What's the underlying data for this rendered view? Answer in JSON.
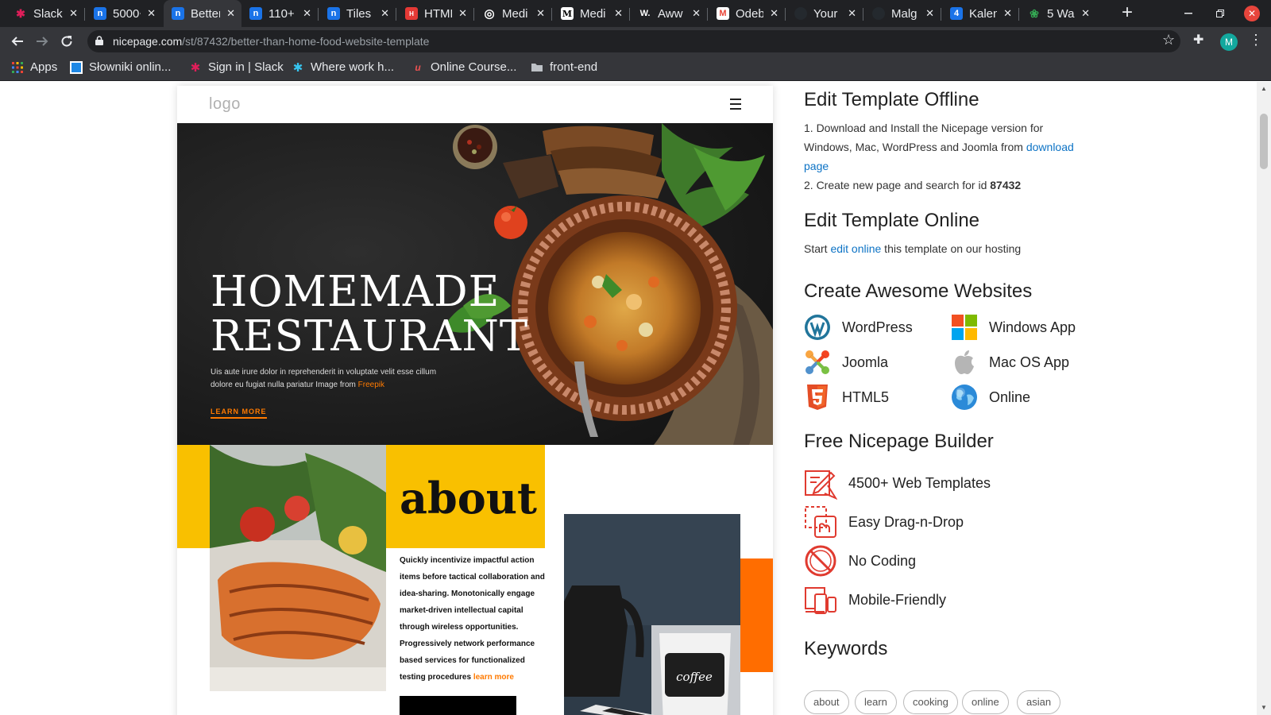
{
  "browser": {
    "tabs": [
      {
        "title": "Slack",
        "fav_color": "#611f69",
        "fav_glyph": "✱",
        "active": false
      },
      {
        "title": "5000+",
        "fav_color": "#1a73e8",
        "fav_glyph": "n",
        "active": false
      },
      {
        "title": "Better",
        "fav_color": "#1a73e8",
        "fav_glyph": "n",
        "active": true
      },
      {
        "title": "110+",
        "fav_color": "#1a73e8",
        "fav_glyph": "n",
        "active": false
      },
      {
        "title": "Tiles",
        "fav_color": "#1a73e8",
        "fav_glyph": "n",
        "active": false
      },
      {
        "title": "HTML",
        "fav_color": "#e53935",
        "fav_glyph": "H",
        "active": false
      },
      {
        "title": "Medi",
        "fav_color": "#5f6368",
        "fav_glyph": "◎",
        "active": false
      },
      {
        "title": "Medi",
        "fav_color": "#000000",
        "fav_glyph": "M",
        "active": false
      },
      {
        "title": "Aww",
        "fav_color": "#202124",
        "fav_glyph": "W.",
        "active": false
      },
      {
        "title": "Odeb",
        "fav_color": "#ffffff",
        "fav_glyph": "M",
        "active": false
      },
      {
        "title": "Your",
        "fav_color": "#24292e",
        "fav_glyph": "",
        "active": false
      },
      {
        "title": "Malg",
        "fav_color": "#24292e",
        "fav_glyph": "",
        "active": false
      },
      {
        "title": "Kalen",
        "fav_color": "#1a73e8",
        "fav_glyph": "4",
        "active": false
      },
      {
        "title": "5 Wa",
        "fav_color": "#34a853",
        "fav_glyph": "❀",
        "active": false
      }
    ],
    "close_glyph": "✕",
    "new_tab_glyph": "+",
    "url_host": "nicepage.com",
    "url_path": "/st/87432/better-than-home-food-website-template",
    "profile_initial": "M",
    "bookmarks": [
      {
        "label": "Apps",
        "icon": "apps-grid-icon"
      },
      {
        "label": "Słowniki onlin...",
        "icon": "dictionary-icon"
      },
      {
        "label": "Sign in | Slack",
        "icon": "slack-icon"
      },
      {
        "label": "Where work h...",
        "icon": "slack-icon"
      },
      {
        "label": "Online Course...",
        "icon": "udemy-icon"
      },
      {
        "label": "front-end",
        "icon": "folder-icon"
      }
    ]
  },
  "preview": {
    "logo": "logo",
    "hero": {
      "title_line1": "HOMEMADE",
      "title_line2": "RESTAURANT",
      "text": "Uis aute irure dolor in reprehenderit in voluptate velit esse cillum dolore eu fugiat nulla pariatur Image from ",
      "text_link": "Freepik",
      "cta": "LEARN MORE"
    },
    "about": {
      "title": "about",
      "text": "Quickly incentivize impactful action items before tactical collaboration and idea-sharing. Monotonically engage market-driven intellectual capital through wireless opportunities. Progressively network performance based services for functionalized testing procedures ",
      "link": "learn more",
      "mug_label": "coffee"
    }
  },
  "info": {
    "offline": {
      "heading": "Edit Template Offline",
      "step1_a": "1. Download and Install the Nicepage version for",
      "step1_b": "Windows, Mac, WordPress and Joomla from ",
      "step1_link": "download",
      "step1_link2": "page",
      "step2": "2. Create new page and search for id ",
      "template_id": "87432"
    },
    "online": {
      "heading": "Edit Template Online",
      "text_a": "Start ",
      "link": "edit online",
      "text_b": " this template on our hosting"
    },
    "create": {
      "heading": "Create Awesome Websites",
      "apps": [
        {
          "label": "WordPress",
          "icon": "wordpress-icon"
        },
        {
          "label": "Windows App",
          "icon": "windows-icon"
        },
        {
          "label": "Joomla",
          "icon": "joomla-icon"
        },
        {
          "label": "Mac OS App",
          "icon": "apple-icon"
        },
        {
          "label": "HTML5",
          "icon": "html5-icon"
        },
        {
          "label": "Online",
          "icon": "globe-icon"
        }
      ]
    },
    "builder": {
      "heading": "Free Nicepage Builder",
      "features": [
        {
          "label": "4500+ Web Templates",
          "icon": "templates-icon"
        },
        {
          "label": "Easy Drag-n-Drop",
          "icon": "drag-drop-icon"
        },
        {
          "label": "No Coding",
          "icon": "no-coding-icon"
        },
        {
          "label": "Mobile-Friendly",
          "icon": "mobile-friendly-icon"
        }
      ]
    },
    "keywords": {
      "heading": "Keywords",
      "items": [
        "about",
        "learn",
        "cooking",
        "online",
        "asian"
      ]
    }
  },
  "colors": {
    "accent": "#ff7a00",
    "yellow": "#f9c000",
    "link": "#0d73c5",
    "icon_red": "#e03a2f"
  }
}
